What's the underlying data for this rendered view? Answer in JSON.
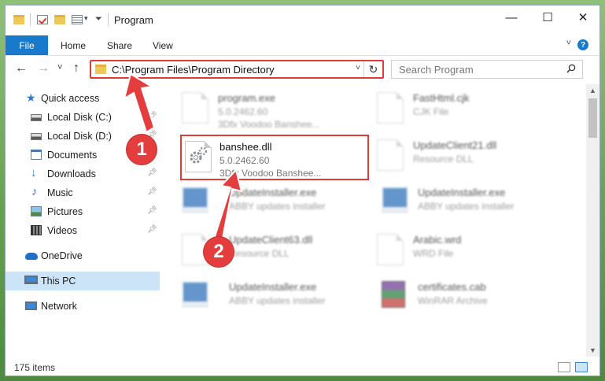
{
  "window": {
    "title": "Program",
    "controls": {
      "minimize": "—",
      "maximize": "☐",
      "close": "✕"
    }
  },
  "ribbon": {
    "tabs": [
      {
        "label": "File",
        "active": true
      },
      {
        "label": "Home"
      },
      {
        "label": "Share"
      },
      {
        "label": "View"
      }
    ],
    "expand_icon": "chevron-down-icon",
    "help_label": "?"
  },
  "navigation": {
    "back": "←",
    "forward": "→",
    "recent": "˅",
    "up": "↑",
    "address": "C:\\Program Files\\Program Directory",
    "address_dropdown": "˅",
    "refresh": "↻",
    "search_placeholder": "Search Program"
  },
  "sidebar": {
    "items": [
      {
        "label": "Quick access",
        "icon": "star-icon",
        "pinned": false
      },
      {
        "label": "Local Disk (C:)",
        "icon": "drive-icon",
        "pinned": true
      },
      {
        "label": "Local Disk (D:)",
        "icon": "drive-icon",
        "pinned": true
      },
      {
        "label": "Documents",
        "icon": "documents-icon",
        "pinned": true
      },
      {
        "label": "Downloads",
        "icon": "download-icon",
        "pinned": true
      },
      {
        "label": "Music",
        "icon": "music-icon",
        "pinned": true
      },
      {
        "label": "Pictures",
        "icon": "pictures-icon",
        "pinned": true
      },
      {
        "label": "Videos",
        "icon": "videos-icon",
        "pinned": true
      },
      {
        "label": "OneDrive",
        "icon": "cloud-icon",
        "pinned": false
      },
      {
        "label": "This PC",
        "icon": "computer-icon",
        "pinned": false,
        "selected": true
      },
      {
        "label": "Network",
        "icon": "network-icon",
        "pinned": false
      }
    ]
  },
  "files": [
    {
      "name": "program.exe",
      "line1": "5.0.2462.60",
      "line2": "3Dfx Voodoo Banshee...",
      "thumb": "exe-gear-icon"
    },
    {
      "name": "FastHtml.cjk",
      "line1": "CJK File",
      "line2": "",
      "thumb": "document-icon"
    },
    {
      "name": "banshee.dll",
      "line1": "5.0.2462.60",
      "line2": "3Dfx Voodoo Banshee...",
      "thumb": "dll-gear-icon",
      "highlighted": true
    },
    {
      "name": "UpdateClient21.dll",
      "line1": "Resource DLL",
      "line2": "",
      "thumb": "dll-gear-icon"
    },
    {
      "name": "UpdateInstaller.exe",
      "line1": "ABBY updates installer",
      "line2": "",
      "thumb": "installer-screen-icon"
    },
    {
      "name": "UpdateInstaller.exe",
      "line1": "ABBY updates installer",
      "line2": "",
      "thumb": "installer-screen-icon"
    },
    {
      "name": "UpdateClient63.dll",
      "line1": "Resource DLL",
      "line2": "",
      "thumb": "dll-gear-icon"
    },
    {
      "name": "Arabic.wrd",
      "line1": "WRD File",
      "line2": "",
      "thumb": "document-icon"
    },
    {
      "name": "UpdateInstaller.exe",
      "line1": "ABBY updates installer",
      "line2": "",
      "thumb": "installer-screen-icon"
    },
    {
      "name": "certificates.cab",
      "line1": "WinRAR Archive",
      "line2": "",
      "thumb": "winrar-archive-icon"
    }
  ],
  "status": {
    "item_count": "175 items"
  },
  "annotations": [
    {
      "label": "1",
      "target": "address bar"
    },
    {
      "label": "2",
      "target": "banshee.dll"
    }
  ],
  "colors": {
    "accent": "#1979ca",
    "annotation": "#e43d3d",
    "selection": "#cce4f7"
  }
}
